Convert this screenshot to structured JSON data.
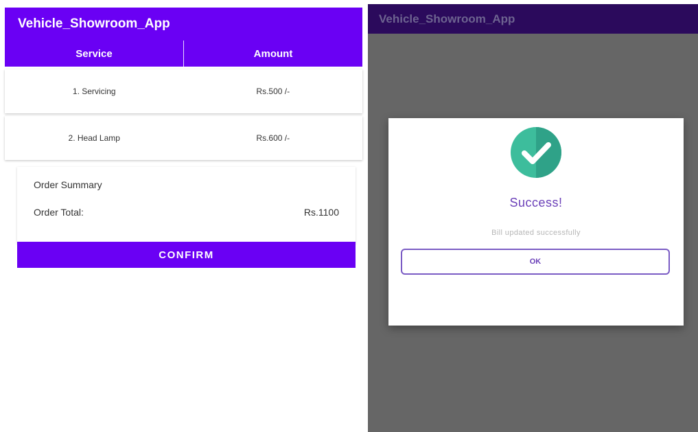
{
  "left_screen": {
    "app_title": "Vehicle_Showroom_App",
    "table": {
      "headers": [
        "Service",
        "Amount"
      ],
      "rows": [
        {
          "service": "1. Servicing",
          "amount": "Rs.500 /-"
        },
        {
          "service": "2. Head Lamp",
          "amount": "Rs.600 /-"
        }
      ]
    },
    "summary": {
      "title": "Order Summary",
      "total_label": "Order Total:",
      "total_value": "Rs.1100"
    },
    "confirm_label": "CONFIRM"
  },
  "right_screen": {
    "app_title": "Vehicle_Showroom_App",
    "dialog": {
      "icon": "check-circle-icon",
      "title": "Success!",
      "message": "Bill updated successfully",
      "ok_label": "OK"
    }
  },
  "colors": {
    "primary": "#6a00f4",
    "dimmed_appbar": "#2b0a5c",
    "overlay": "#666666",
    "success_green": "#3dbd9c",
    "dialog_accent": "#6a3fb8"
  }
}
